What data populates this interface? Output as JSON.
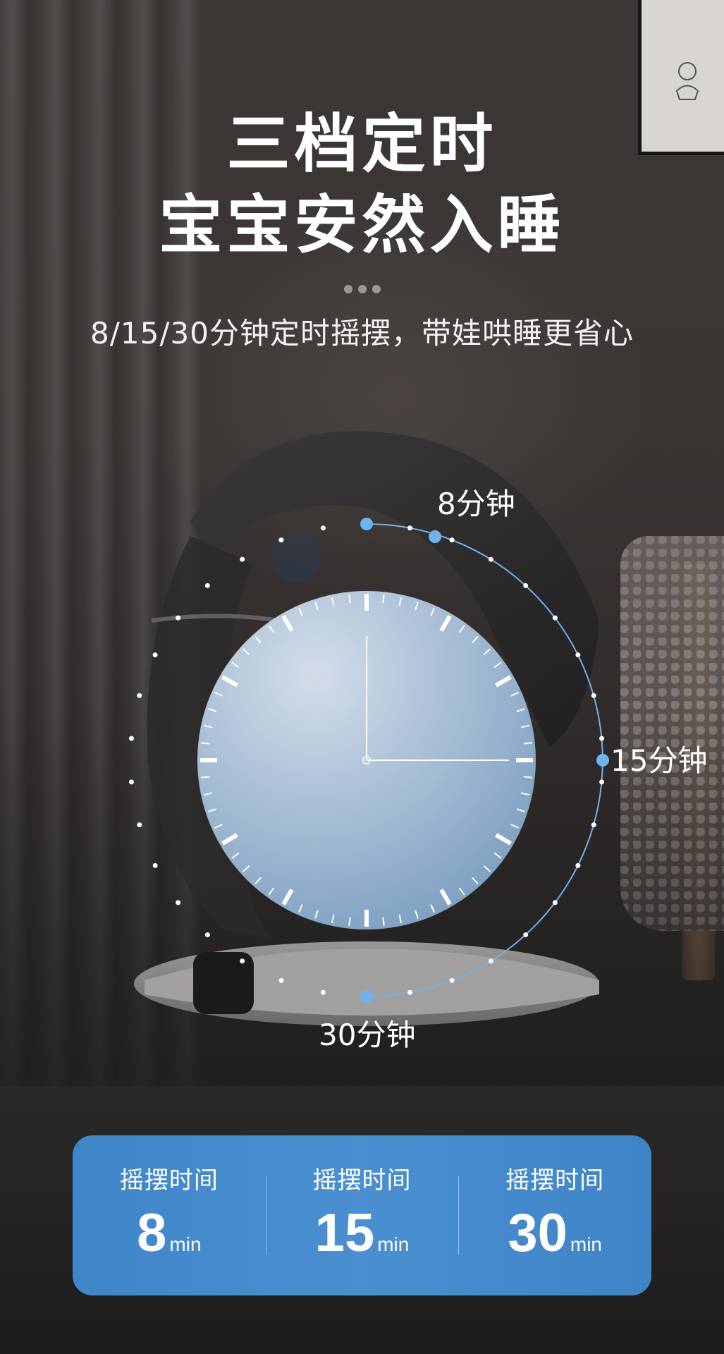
{
  "heading": {
    "line1": "三档定时",
    "line2": "宝宝安然入睡",
    "subtitle": "8/15/30分钟定时摇摆，带娃哄睡更省心"
  },
  "dial": {
    "marker_labels": {
      "m8": "8分钟",
      "m15": "15分钟",
      "m30": "30分钟"
    },
    "accent_color": "#6fb2ee",
    "face_colors": [
      "#c9d6e6",
      "#7fa3c6"
    ]
  },
  "panel": {
    "background": "#4a8fd0",
    "items": [
      {
        "label": "摇摆时间",
        "value": "8",
        "unit": "min"
      },
      {
        "label": "摇摆时间",
        "value": "15",
        "unit": "min"
      },
      {
        "label": "摇摆时间",
        "value": "30",
        "unit": "min"
      }
    ]
  }
}
